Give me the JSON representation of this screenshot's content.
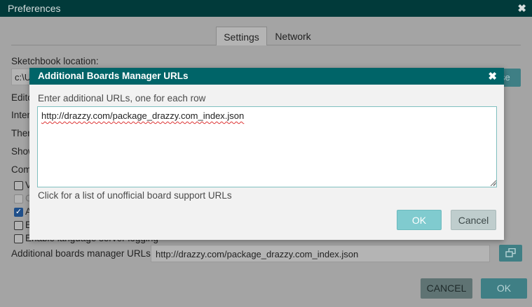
{
  "preferences": {
    "title": "Preferences",
    "close_icon": "close-icon",
    "tabs": [
      {
        "label": "Settings",
        "active": true
      },
      {
        "label": "Network",
        "active": false
      }
    ],
    "sketchbook_label": "Sketchbook location:",
    "sketchbook_value_visible": "c:\\U",
    "browse_label_visible": "se",
    "partial_labels": [
      "Edito",
      "Inter",
      "Ther",
      "Show",
      "Com"
    ],
    "checkboxes": [
      {
        "text": "V",
        "checked": false,
        "disabled": false
      },
      {
        "text": "C",
        "checked": false,
        "disabled": true
      },
      {
        "text": "A",
        "checked": true,
        "disabled": false
      },
      {
        "text": "E",
        "checked": false,
        "disabled": false
      },
      {
        "text": "Enable language server logging",
        "checked": false,
        "disabled": false
      }
    ],
    "additional_urls_label": "Additional boards manager URLs:",
    "additional_urls_value": "http://drazzy.com/package_drazzy.com_index.json",
    "open_urls_icon": "open-window-icon",
    "cancel_label": "CANCEL",
    "ok_label": "OK"
  },
  "dialog": {
    "title": "Additional Boards Manager URLs",
    "close_icon": "close-icon",
    "instruction": "Enter additional URLs, one for each row",
    "urls_text": "http://drazzy.com/package_drazzy.com_index.json",
    "link_text": "Click for a list of unofficial board support URLs",
    "ok_label": "OK",
    "cancel_label": "Cancel"
  },
  "colors": {
    "title_bar_dark": "#013a3a",
    "dialog_title_bar": "#006468",
    "accent_teal": "#80cbcf",
    "overlay_gray": "#a4a4a4"
  }
}
